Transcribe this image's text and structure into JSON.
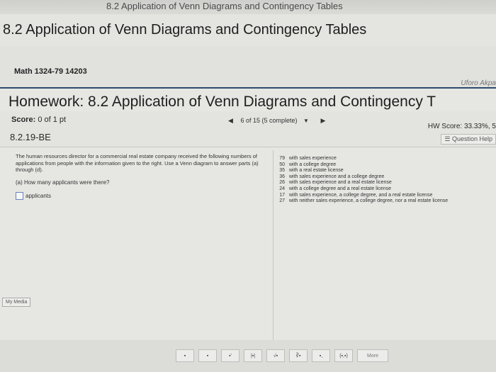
{
  "browser": {
    "tab_title": "8.2 Application of Venn Diagrams and Contingency Tables"
  },
  "page": {
    "heading": "8.2 Application of Venn Diagrams and Contingency Tables"
  },
  "course": {
    "name": "Math 1324-79 14203",
    "user": "Uforo Akpa"
  },
  "homework": {
    "title": "Homework: 8.2 Application of Venn Diagrams and Contingency T",
    "score_label": "Score:",
    "score_value": "0 of 1 pt",
    "progress": "6 of 15 (5 complete)",
    "hw_score": "HW Score: 33.33%, 5",
    "question_id": "8.2.19-BE",
    "question_help": "Question Help"
  },
  "problem": {
    "text": "The human resources director for a commercial real estate company received the following numbers of applications from people with the information given to the right. Use a Venn diagram to answer parts (a) through (d).",
    "part_a": "(a) How many applicants were there?",
    "answer_suffix": "applicants"
  },
  "data_list": [
    {
      "n": "79",
      "desc": "with sales experience"
    },
    {
      "n": "50",
      "desc": "with a college degree"
    },
    {
      "n": "35",
      "desc": "with a real estate license"
    },
    {
      "n": "36",
      "desc": "with sales experience and a college degree"
    },
    {
      "n": "26",
      "desc": "with sales experience and a real estate license"
    },
    {
      "n": "24",
      "desc": "with a college degree and a real estate license"
    },
    {
      "n": "17",
      "desc": "with sales experience, a college degree, and a real estate license"
    },
    {
      "n": "27",
      "desc": "with neither sales experience, a college degree, nor a real estate license"
    }
  ],
  "media_button": "My Media",
  "toolbar": {
    "tools": [
      "▪",
      "▪",
      "▪'",
      "|▪|",
      "√▪",
      "∛▪",
      "▪,",
      "(▪,▪)"
    ],
    "more": "More"
  }
}
